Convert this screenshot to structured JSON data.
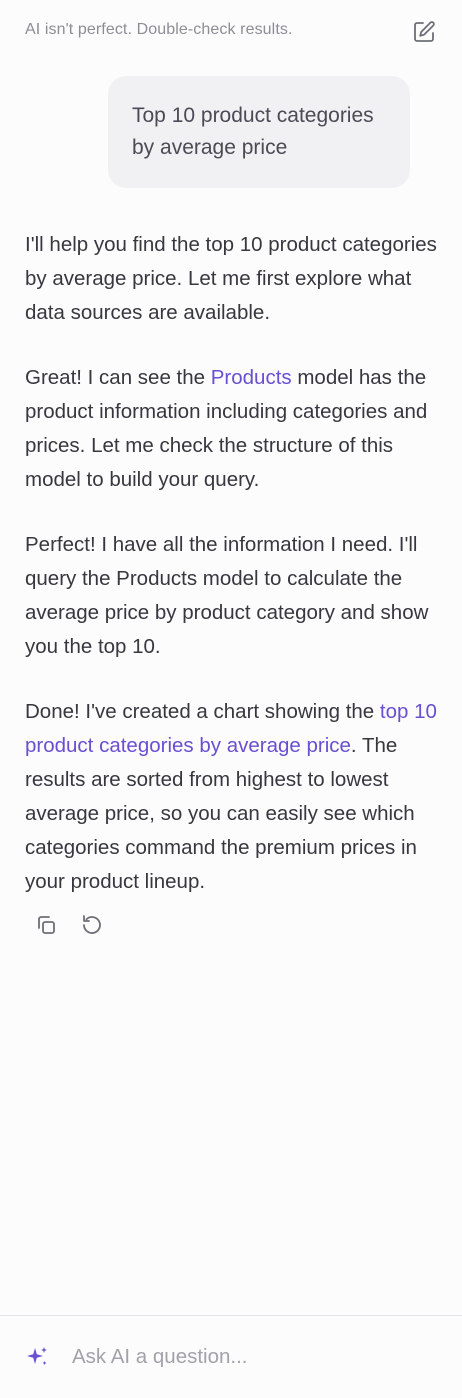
{
  "header": {
    "disclaimer": "AI isn't perfect. Double-check results.",
    "edit_icon": "edit-square-icon"
  },
  "user_message": {
    "text": "Top 10 product categories by average price"
  },
  "assistant_message": {
    "p1": "I'll help you find the top 10 product categories by average price. Let me first explore what data sources are available.",
    "p2_before": "Great! I can see the ",
    "p2_link": "Products",
    "p2_after": " model has the product information including categories and prices. Let me check the structure of this model to build your query.",
    "p3": "Perfect! I have all the information I need. I'll query the Products model to calculate the average price by product category and show you the top 10.",
    "p4_before": "Done! I've created a chart showing the ",
    "p4_link": "top 10 product categories by average price",
    "p4_after": ". The results are sorted from highest to lowest average price, so you can easily see which categories command the premium prices in your product lineup."
  },
  "message_actions": {
    "copy_icon": "copy-icon",
    "retry_icon": "retry-icon"
  },
  "composer": {
    "placeholder": "Ask AI a question...",
    "value": "",
    "sparkle_icon": "sparkle-icon"
  },
  "colors": {
    "accent": "#6a4fd1",
    "text": "#37373f",
    "muted": "#8d8d96",
    "bubble": "#f1f1f4",
    "background": "#fcfcfc"
  }
}
